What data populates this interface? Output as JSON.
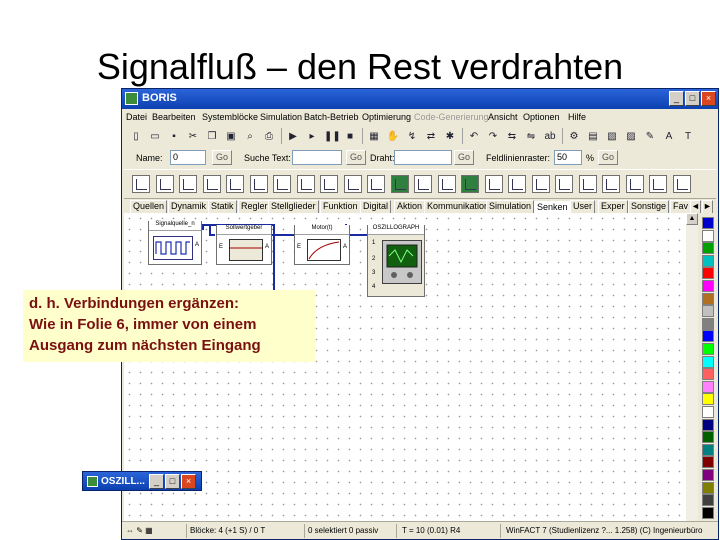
{
  "slide": {
    "title": "Signalfluß – den Rest verdrahten"
  },
  "window": {
    "title": "BORIS",
    "minimize": "_",
    "maximize": "□",
    "close": "×"
  },
  "menu": {
    "items": [
      {
        "label": "Datei"
      },
      {
        "label": "Bearbeiten"
      },
      {
        "label": "Systemblöcke"
      },
      {
        "label": "Simulation"
      },
      {
        "label": "Batch-Betrieb"
      },
      {
        "label": "Optimierung"
      },
      {
        "label": "Code-Generierung",
        "disabled": true
      },
      {
        "label": "Ansicht"
      },
      {
        "label": "Optionen"
      },
      {
        "label": "Hilfe"
      }
    ]
  },
  "toolbar": {
    "buttons": [
      {
        "icon": "new-file-icon",
        "glyph": "▯"
      },
      {
        "icon": "open-folder-icon",
        "glyph": "▭"
      },
      {
        "icon": "save-icon",
        "glyph": "▪"
      },
      {
        "icon": "cut-icon",
        "glyph": "✂"
      },
      {
        "icon": "copy-icon",
        "glyph": "❐"
      },
      {
        "icon": "paste-icon",
        "glyph": "▣"
      },
      {
        "icon": "zoom-icon",
        "glyph": "⌕"
      },
      {
        "icon": "print-icon",
        "glyph": "⎙"
      },
      {
        "icon": "run-icon",
        "glyph": "▶"
      },
      {
        "icon": "step-icon",
        "glyph": "▸"
      },
      {
        "icon": "pause-icon",
        "glyph": "❚❚"
      },
      {
        "icon": "stop-icon",
        "glyph": "■"
      },
      {
        "icon": "grid-icon",
        "glyph": "▦"
      },
      {
        "icon": "hand-icon",
        "glyph": "✋"
      },
      {
        "icon": "wire-icon",
        "glyph": "↯"
      },
      {
        "icon": "connect-icon",
        "glyph": "⇄"
      },
      {
        "icon": "bug-icon",
        "glyph": "✱"
      },
      {
        "icon": "undo-icon",
        "glyph": "↶"
      },
      {
        "icon": "redo-icon",
        "glyph": "↷"
      },
      {
        "icon": "arrows-icon",
        "glyph": "⇆"
      },
      {
        "icon": "flip-icon",
        "glyph": "⇋"
      },
      {
        "icon": "text-abc-icon",
        "glyph": "ab"
      },
      {
        "icon": "settings-icon",
        "glyph": "⚙"
      },
      {
        "icon": "library-icon",
        "glyph": "▤"
      },
      {
        "icon": "block-edit-icon",
        "glyph": "▧"
      },
      {
        "icon": "block-config-icon",
        "glyph": "▨"
      },
      {
        "icon": "wand-icon",
        "glyph": "✎"
      },
      {
        "icon": "font-icon",
        "glyph": "A"
      },
      {
        "icon": "text-icon",
        "glyph": "T"
      }
    ]
  },
  "search_bar": {
    "name_label": "Name:",
    "name_value": "0",
    "name_go": "Go",
    "text_label": "Suche Text:",
    "text_value": "",
    "text_go": "Go",
    "wire_label": "Draht:",
    "wire_value": "",
    "wire_go": "Go",
    "grid_label": "Feldlinienraster:",
    "grid_value": "50",
    "grid_unit": "%",
    "grid_go": "Go"
  },
  "palette": {
    "items": [
      {
        "icon": "signal-generator-icon"
      },
      {
        "icon": "chart-icon"
      },
      {
        "icon": "step-signal-icon"
      },
      {
        "icon": "ramp-icon"
      },
      {
        "icon": "bar-chart-icon"
      },
      {
        "icon": "plot-icon"
      },
      {
        "icon": "scatter-icon"
      },
      {
        "icon": "histogram-icon"
      },
      {
        "icon": "matrix-icon"
      },
      {
        "icon": "switch-icon"
      },
      {
        "icon": "mux-icon"
      },
      {
        "icon": "scope-icon",
        "variant": "green"
      },
      {
        "icon": "xy-scope-icon"
      },
      {
        "icon": "display-icon"
      },
      {
        "icon": "monitor-icon",
        "variant": "green"
      },
      {
        "icon": "meter-icon"
      },
      {
        "icon": "level-icon"
      },
      {
        "icon": "bar-gauge-icon"
      },
      {
        "icon": "lamp-icon"
      },
      {
        "icon": "numeric-display-icon"
      },
      {
        "icon": "led-icon"
      },
      {
        "icon": "gauge-icon"
      },
      {
        "icon": "warning-icon"
      },
      {
        "icon": "file-out-icon"
      }
    ]
  },
  "tabs": [
    {
      "label": "Quellen"
    },
    {
      "label": "Dynamik"
    },
    {
      "label": "Statik"
    },
    {
      "label": "Regler"
    },
    {
      "label": "Stellglieder"
    },
    {
      "label": "Funktion"
    },
    {
      "label": "Digital"
    },
    {
      "label": "Aktion"
    },
    {
      "label": "Kommunikation"
    },
    {
      "label": "Simulation"
    },
    {
      "label": "Senken",
      "active": true
    },
    {
      "label": "User"
    },
    {
      "label": "Exper"
    },
    {
      "label": "Sonstige"
    },
    {
      "label": "Fav"
    }
  ],
  "tab_scroll_left": "◄",
  "tab_scroll_right": "►",
  "scroll_up": "▲",
  "blocks": {
    "signal": {
      "label": "Signalquelle_n",
      "port_out": "A"
    },
    "setpoint": {
      "label": "Sollwertgeber",
      "port_in": "E",
      "port_out": "A"
    },
    "motor": {
      "label": "Motor(t)",
      "port_in": "E",
      "port_out": "A"
    },
    "scope": {
      "label": "OSZILLOGRAPH",
      "port1": "1",
      "port2": "2",
      "port3": "3",
      "port4": "4"
    }
  },
  "note": {
    "line1": "d. h. Verbindungen ergänzen:",
    "line2": "Wie in Folie 6, immer von einem",
    "line3": "Ausgang zum nächsten Eingang"
  },
  "mini_window": {
    "title": "OSZILL..."
  },
  "status": {
    "blocks": "Blöcke: 4 (+1 S) / 0 T",
    "state": "0 selektiert  0 passiv",
    "time": "T = 10  (0.01) R4",
    "product": "WinFACT 7 (Studienlizenz ?... 1.258) (C) Ingenieurbüro"
  },
  "colors": {
    "title_blue": "#0c40b0",
    "wire": "#1a2aa0",
    "note_bg": "#ffffcc",
    "note_text": "#7a1010",
    "color_strip": [
      "#0000cc",
      "#ffffff",
      "#00a000",
      "#00c0c0",
      "#ff0000",
      "#ff00ff",
      "#b07020",
      "#c0c0c0",
      "#808080",
      "#0000ff",
      "#00ff00",
      "#00ffff",
      "#ff6060",
      "#ff80ff",
      "#ffff00",
      "#ffffff",
      "#000080",
      "#006000",
      "#008080",
      "#800000",
      "#800080",
      "#808000",
      "#404040",
      "#000000"
    ]
  }
}
